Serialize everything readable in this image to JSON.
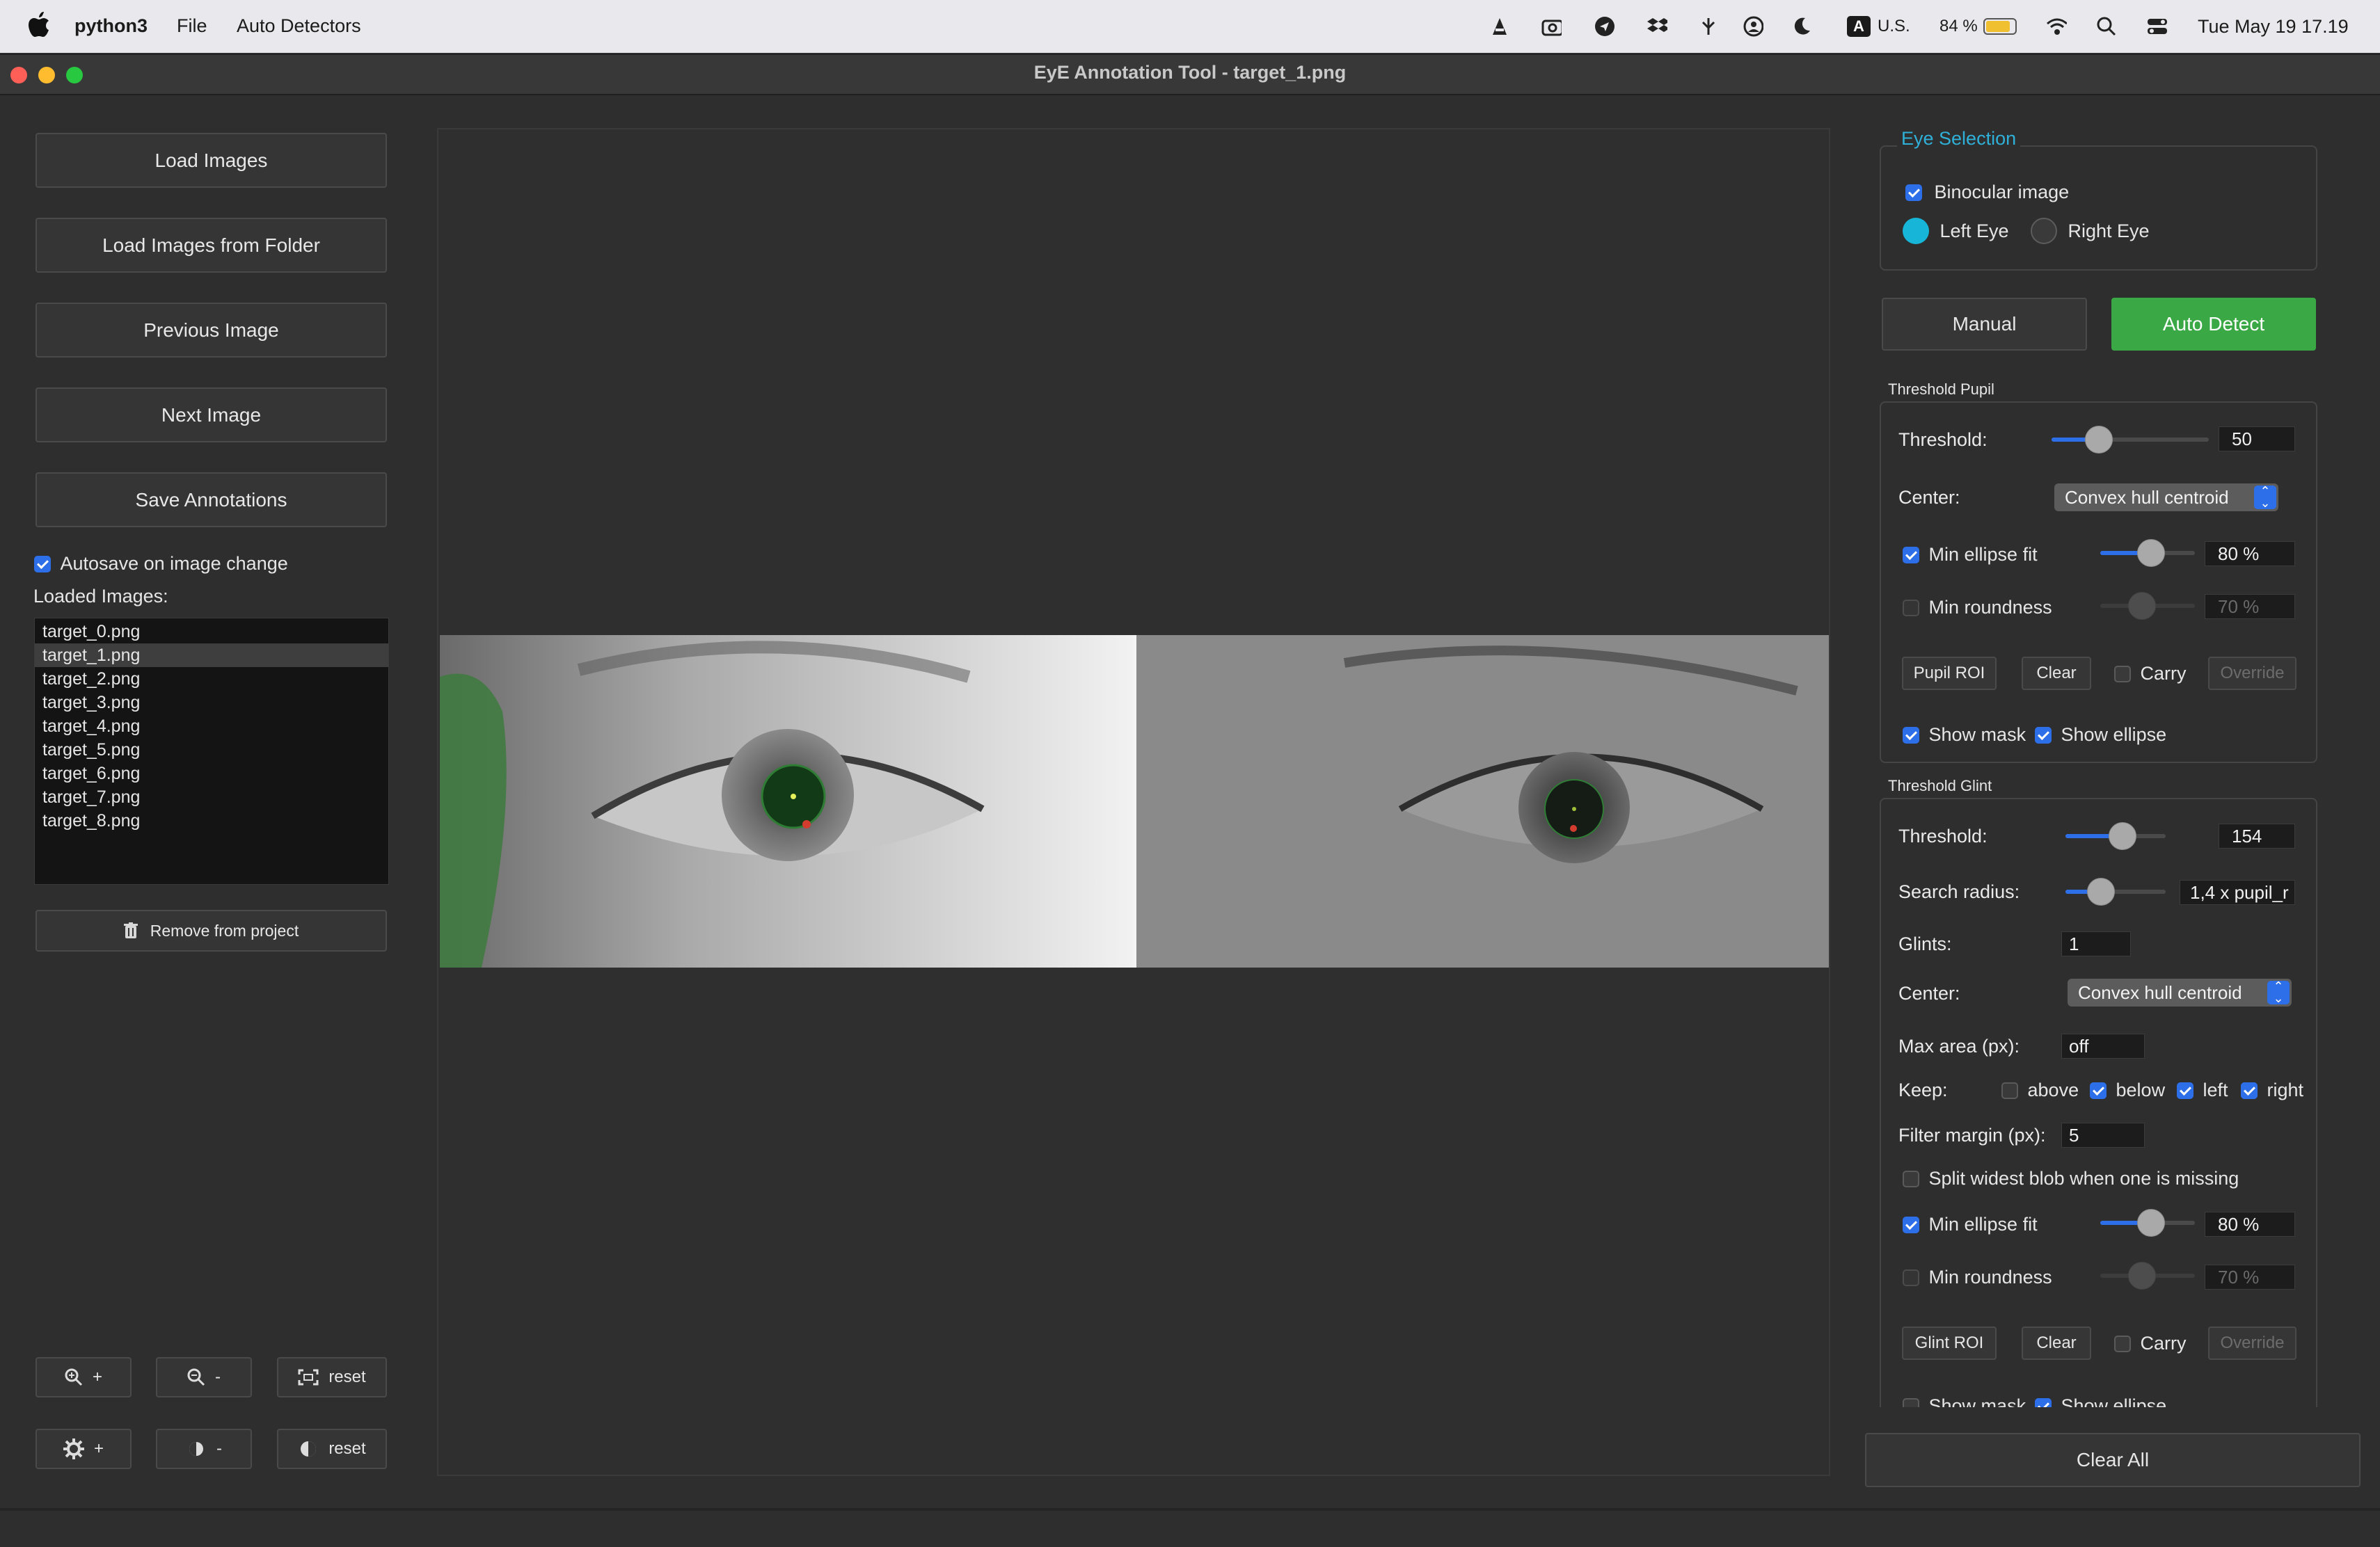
{
  "menubar": {
    "app_name": "python3",
    "menus": [
      "File",
      "Auto Detectors"
    ],
    "input_source": "U.S.",
    "battery": "84 %",
    "clock": "Tue May 19  17.19"
  },
  "window": {
    "title": "EyE Annotation Tool - target_1.png"
  },
  "left_panel": {
    "buttons": [
      "Load Images",
      "Load Images from Folder",
      "Previous Image",
      "Next Image",
      "Save Annotations"
    ],
    "autosave_label": "Autosave on image change",
    "autosave_checked": true,
    "loaded_label": "Loaded Images:",
    "files": [
      "target_0.png",
      "target_1.png",
      "target_2.png",
      "target_3.png",
      "target_4.png",
      "target_5.png",
      "target_6.png",
      "target_7.png",
      "target_8.png"
    ],
    "selected_file": "target_1.png",
    "remove_label": "Remove from project",
    "zoom_in": "+",
    "zoom_out": "-",
    "zoom_reset": "reset",
    "bright_up": "+",
    "bright_down": "-",
    "bright_reset": "reset"
  },
  "right_panel": {
    "eye_selection": {
      "title": "Eye Selection",
      "binocular_label": "Binocular image",
      "binocular_checked": true,
      "left_eye": "Left Eye",
      "right_eye": "Right Eye",
      "selected": "left"
    },
    "manual_label": "Manual",
    "auto_detect_label": "Auto Detect",
    "pupil": {
      "title": "Threshold Pupil",
      "threshold_label": "Threshold:",
      "threshold_value": "50",
      "threshold_fraction": 0.26,
      "center_label": "Center:",
      "center_value": "Convex hull centroid",
      "min_ellipse_label": "Min ellipse fit",
      "min_ellipse_value": "80 %",
      "min_ellipse_fraction": 0.55,
      "min_round_label": "Min roundness",
      "min_round_value": "70 %",
      "roi_label": "Pupil ROI",
      "clear_label": "Clear",
      "carry_label": "Carry",
      "override_label": "Override",
      "show_mask": "Show mask",
      "show_ellipse": "Show ellipse"
    },
    "glint": {
      "title": "Threshold Glint",
      "threshold_label": "Threshold:",
      "threshold_value": "154",
      "threshold_fraction": 0.6,
      "search_label": "Search radius:",
      "search_value": "1,4 x pupil_r",
      "search_fraction": 0.3,
      "glints_label": "Glints:",
      "glints_value": "1",
      "center_label": "Center:",
      "center_value": "Convex hull centroid",
      "max_area_label": "Max area (px):",
      "max_area_value": "off",
      "keep_label": "Keep:",
      "keep_above": "above",
      "keep_below": "below",
      "keep_left": "left",
      "keep_right": "right",
      "filter_label": "Filter margin (px):",
      "filter_value": "5",
      "split_label": "Split widest blob when one is missing",
      "min_ellipse_label": "Min ellipse fit",
      "min_ellipse_value": "80 %",
      "min_ellipse_fraction": 0.55,
      "min_round_label": "Min roundness",
      "min_round_value": "70 %",
      "roi_label": "Glint ROI",
      "clear_label": "Clear",
      "carry_label": "Carry",
      "override_label": "Override",
      "show_mask": "Show mask",
      "show_ellipse": "Show ellipse"
    },
    "clear_all_label": "Clear All"
  },
  "colors": {
    "accent_blue": "#2d6fe8",
    "auto_detect_green": "#3aa845",
    "eye_selection_title": "#2fb0d8",
    "left_eye_radio": "#17b6d8"
  }
}
